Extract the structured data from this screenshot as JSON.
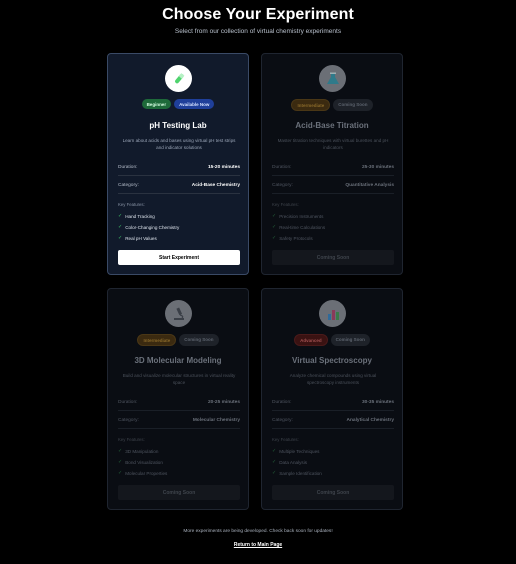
{
  "page": {
    "title": "Choose Your Experiment",
    "subtitle": "Select from our collection of virtual chemistry experiments"
  },
  "labels": {
    "duration": "Duration:",
    "category": "Category:",
    "key_features": "Key Features:"
  },
  "experiments": [
    {
      "title": "pH Testing Lab",
      "icon": "test-tube-icon",
      "level": "Beginner",
      "status": "Available Now",
      "description": "Learn about acids and bases using virtual pH test strips and indicator solutions",
      "duration": "15-20 minutes",
      "category": "Acid-Base Chemistry",
      "features": [
        "Hand Tracking",
        "Color-Changing Chemistry",
        "Real pH Values"
      ],
      "button": "Start Experiment"
    },
    {
      "title": "Acid-Base Titration",
      "icon": "flask-icon",
      "level": "Intermediate",
      "status": "Coming Soon",
      "description": "Master titration techniques with virtual burettes and pH indicators",
      "duration": "25-30 minutes",
      "category": "Quantitative Analysis",
      "features": [
        "Precision Instruments",
        "Real-time Calculations",
        "Safety Protocols"
      ],
      "button": "Coming Soon"
    },
    {
      "title": "3D Molecular Modeling",
      "icon": "microscope-icon",
      "level": "Intermediate",
      "status": "Coming Soon",
      "description": "Build and visualize molecular structures in virtual reality space",
      "duration": "20-25 minutes",
      "category": "Molecular Chemistry",
      "features": [
        "3D Manipulation",
        "Bond Visualization",
        "Molecular Properties"
      ],
      "button": "Coming Soon"
    },
    {
      "title": "Virtual Spectroscopy",
      "icon": "bar-chart-icon",
      "level": "Advanced",
      "status": "Coming Soon",
      "description": "Analyze chemical compounds using virtual spectroscopy instruments",
      "duration": "30-35 minutes",
      "category": "Analytical Chemistry",
      "features": [
        "Multiple Techniques",
        "Data Analysis",
        "Sample Identification"
      ],
      "button": "Coming Soon"
    }
  ],
  "footer": {
    "note": "More experiments are being developed. Check back soon for updates!",
    "link": "Return to Main Page"
  },
  "colors": {
    "background": "#000000",
    "check": "#3fc46a",
    "beginner": "#1e6a3a",
    "available": "#1f3f9a"
  }
}
